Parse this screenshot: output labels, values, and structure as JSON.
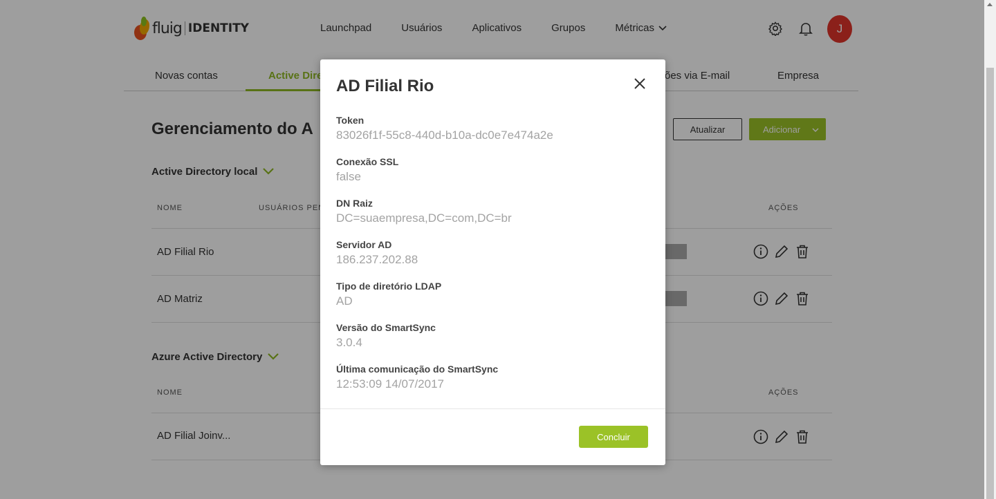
{
  "header": {
    "logo_text": "fluig",
    "logo_product": "IDENTITY",
    "nav": [
      "Launchpad",
      "Usuários",
      "Aplicativos",
      "Grupos",
      "Métricas"
    ],
    "avatar_initial": "J"
  },
  "tabs": {
    "items": [
      "Novas contas",
      "Active Dire",
      "ões via E-mail",
      "Empresa"
    ],
    "active_index": 1
  },
  "main": {
    "title": "Gerenciamento do A",
    "refresh_label": "Atualizar",
    "add_label": "Adicionar",
    "section_local": {
      "title": "Active Directory local",
      "col_name": "NOME",
      "col_pending": "USUÁRIOS PEND",
      "col_actions": "AÇÕES",
      "rows": [
        {
          "name": "AD Filial Rio"
        },
        {
          "name": "AD Matriz"
        }
      ]
    },
    "section_azure": {
      "title": "Azure Active Directory",
      "col_name": "NOME",
      "col_actions": "AÇÕES",
      "rows": [
        {
          "name": "AD Filial Joinv..."
        }
      ]
    }
  },
  "modal": {
    "title": "AD Filial Rio",
    "fields": [
      {
        "label": "Token",
        "value": "83026f1f-55c8-440d-b10a-dc0e7e474a2e"
      },
      {
        "label": "Conexão SSL",
        "value": "false"
      },
      {
        "label": "DN Raiz",
        "value": "DC=suaempresa,DC=com,DC=br"
      },
      {
        "label": "Servidor AD",
        "value": "186.237.202.88"
      },
      {
        "label": "Tipo de diretório LDAP",
        "value": "AD"
      },
      {
        "label": "Versão do SmartSync",
        "value": "3.0.4"
      },
      {
        "label": "Última comunicação do SmartSync",
        "value": "12:53:09 14/07/2017"
      }
    ],
    "confirm_label": "Concluir"
  },
  "colors": {
    "accent": "#9bc227",
    "avatar": "#e0342a",
    "overlay": "rgba(0,0,0,0.38)"
  },
  "icons": [
    "gear-icon",
    "bell-icon",
    "chevron-down-icon",
    "info-icon",
    "pencil-icon",
    "trash-icon",
    "close-icon"
  ]
}
